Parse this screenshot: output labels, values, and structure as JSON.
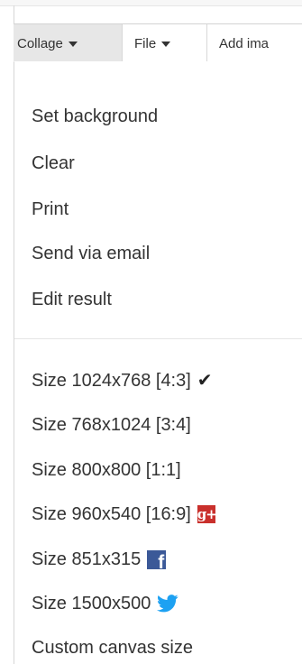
{
  "toolbar": {
    "collage_label": "Collage",
    "file_label": "File",
    "add_image_label": "Add ima"
  },
  "menu": {
    "items": [
      {
        "label": "Set background"
      },
      {
        "label": "Clear"
      },
      {
        "label": "Print"
      },
      {
        "label": "Send via email"
      },
      {
        "label": "Edit result"
      }
    ],
    "sizes": [
      {
        "label": "Size 1024x768 [4:3]",
        "icon": "checkmark-icon"
      },
      {
        "label": "Size 768x1024 [3:4]"
      },
      {
        "label": "Size 800x800 [1:1]"
      },
      {
        "label": "Size 960x540 [16:9]",
        "icon": "google-plus-icon"
      },
      {
        "label": "Size 851x315",
        "icon": "facebook-icon"
      },
      {
        "label": "Size 1500x500",
        "icon": "twitter-icon"
      },
      {
        "label": "Custom canvas size"
      }
    ]
  },
  "icons": {
    "check_glyph": "✔",
    "gplus_text": "g+",
    "fb_text": "f"
  },
  "colors": {
    "active_tab_bg": "#e7e7e7",
    "gplus": "#c9302c",
    "facebook": "#3b5998",
    "twitter": "#1da1f2",
    "text": "#333333"
  }
}
